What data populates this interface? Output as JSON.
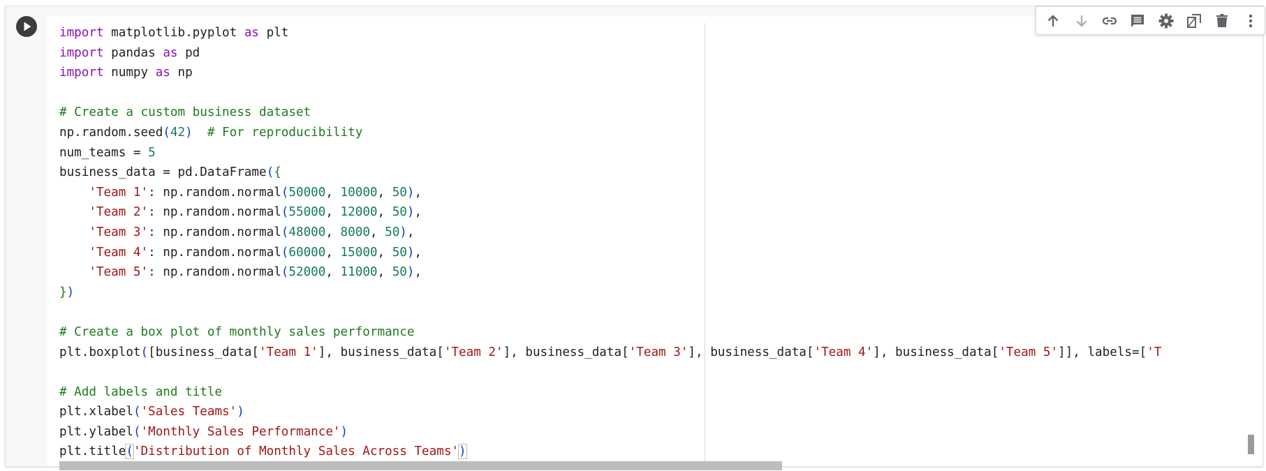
{
  "cell": {
    "run_button_label": "Run cell",
    "code_lines": [
      [
        {
          "t": "import",
          "c": "kw"
        },
        {
          "t": " matplotlib.pyplot "
        },
        {
          "t": "as",
          "c": "kw"
        },
        {
          "t": " plt"
        }
      ],
      [
        {
          "t": "import",
          "c": "kw"
        },
        {
          "t": " pandas "
        },
        {
          "t": "as",
          "c": "kw"
        },
        {
          "t": " pd"
        }
      ],
      [
        {
          "t": "import",
          "c": "kw"
        },
        {
          "t": " numpy "
        },
        {
          "t": "as",
          "c": "kw"
        },
        {
          "t": " np"
        }
      ],
      [],
      [
        {
          "t": "# Create a custom business dataset",
          "c": "cm"
        }
      ],
      [
        {
          "t": "np.random.seed"
        },
        {
          "t": "(",
          "c": "br"
        },
        {
          "t": "42",
          "c": "nm"
        },
        {
          "t": ")",
          "c": "br"
        },
        {
          "t": "  "
        },
        {
          "t": "# For reproducibility",
          "c": "cm"
        }
      ],
      [
        {
          "t": "num_teams = "
        },
        {
          "t": "5",
          "c": "nm"
        }
      ],
      [
        {
          "t": "business_data = pd.DataFrame"
        },
        {
          "t": "(",
          "c": "br"
        },
        {
          "t": "{",
          "c": "cm"
        }
      ],
      [
        {
          "t": "    "
        },
        {
          "t": "'Team 1'",
          "c": "st"
        },
        {
          "t": ": np.random.normal"
        },
        {
          "t": "(",
          "c": "br"
        },
        {
          "t": "50000",
          "c": "nm"
        },
        {
          "t": ", "
        },
        {
          "t": "10000",
          "c": "nm"
        },
        {
          "t": ", "
        },
        {
          "t": "50",
          "c": "nm"
        },
        {
          "t": ")",
          "c": "br"
        },
        {
          "t": ","
        }
      ],
      [
        {
          "t": "    "
        },
        {
          "t": "'Team 2'",
          "c": "st"
        },
        {
          "t": ": np.random.normal"
        },
        {
          "t": "(",
          "c": "br"
        },
        {
          "t": "55000",
          "c": "nm"
        },
        {
          "t": ", "
        },
        {
          "t": "12000",
          "c": "nm"
        },
        {
          "t": ", "
        },
        {
          "t": "50",
          "c": "nm"
        },
        {
          "t": ")",
          "c": "br"
        },
        {
          "t": ","
        }
      ],
      [
        {
          "t": "    "
        },
        {
          "t": "'Team 3'",
          "c": "st"
        },
        {
          "t": ": np.random.normal"
        },
        {
          "t": "(",
          "c": "br"
        },
        {
          "t": "48000",
          "c": "nm"
        },
        {
          "t": ", "
        },
        {
          "t": "8000",
          "c": "nm"
        },
        {
          "t": ", "
        },
        {
          "t": "50",
          "c": "nm"
        },
        {
          "t": ")",
          "c": "br"
        },
        {
          "t": ","
        }
      ],
      [
        {
          "t": "    "
        },
        {
          "t": "'Team 4'",
          "c": "st"
        },
        {
          "t": ": np.random.normal"
        },
        {
          "t": "(",
          "c": "br"
        },
        {
          "t": "60000",
          "c": "nm"
        },
        {
          "t": ", "
        },
        {
          "t": "15000",
          "c": "nm"
        },
        {
          "t": ", "
        },
        {
          "t": "50",
          "c": "nm"
        },
        {
          "t": ")",
          "c": "br"
        },
        {
          "t": ","
        }
      ],
      [
        {
          "t": "    "
        },
        {
          "t": "'Team 5'",
          "c": "st"
        },
        {
          "t": ": np.random.normal"
        },
        {
          "t": "(",
          "c": "br"
        },
        {
          "t": "52000",
          "c": "nm"
        },
        {
          "t": ", "
        },
        {
          "t": "11000",
          "c": "nm"
        },
        {
          "t": ", "
        },
        {
          "t": "50",
          "c": "nm"
        },
        {
          "t": ")",
          "c": "br"
        },
        {
          "t": ","
        }
      ],
      [
        {
          "t": "}",
          "c": "cm"
        },
        {
          "t": ")",
          "c": "br"
        }
      ],
      [],
      [
        {
          "t": "# Create a box plot of monthly sales performance",
          "c": "cm"
        }
      ],
      [
        {
          "t": "plt.boxplot"
        },
        {
          "t": "(",
          "c": "br"
        },
        {
          "t": "["
        },
        {
          "t": "business_data["
        },
        {
          "t": "'Team 1'",
          "c": "st"
        },
        {
          "t": "], business_data["
        },
        {
          "t": "'Team 2'",
          "c": "st"
        },
        {
          "t": "], business_data["
        },
        {
          "t": "'Team 3'",
          "c": "st"
        },
        {
          "t": "], business_data["
        },
        {
          "t": "'Team 4'",
          "c": "st"
        },
        {
          "t": "], business_data["
        },
        {
          "t": "'Team 5'",
          "c": "st"
        },
        {
          "t": "]], labels=["
        },
        {
          "t": "'T",
          "c": "st"
        }
      ],
      [],
      [
        {
          "t": "# Add labels and title",
          "c": "cm"
        }
      ],
      [
        {
          "t": "plt.xlabel"
        },
        {
          "t": "(",
          "c": "br"
        },
        {
          "t": "'Sales Teams'",
          "c": "st"
        },
        {
          "t": ")",
          "c": "br"
        }
      ],
      [
        {
          "t": "plt.ylabel"
        },
        {
          "t": "(",
          "c": "br"
        },
        {
          "t": "'Monthly Sales Performance'",
          "c": "st"
        },
        {
          "t": ")",
          "c": "br"
        }
      ],
      [
        {
          "t": "plt.title"
        },
        {
          "t": "(",
          "c": "br cur-br"
        },
        {
          "t": "'Distribution of Monthly Sales Across Teams'",
          "c": "st"
        },
        {
          "t": ")",
          "c": "br cur-br"
        }
      ]
    ]
  },
  "toolbar": {
    "buttons": [
      {
        "name": "move-cell-up-button",
        "icon": "arrow-up-icon",
        "color": "#5f6368"
      },
      {
        "name": "move-cell-down-button",
        "icon": "arrow-down-icon",
        "color": "#b0b0b0"
      },
      {
        "name": "copy-link-button",
        "icon": "link-icon",
        "color": "#5f6368"
      },
      {
        "name": "add-comment-button",
        "icon": "comment-icon",
        "color": "#5f6368"
      },
      {
        "name": "cell-settings-button",
        "icon": "gear-icon",
        "color": "#5f6368"
      },
      {
        "name": "mirror-cell-button",
        "icon": "mirror-cell-icon",
        "color": "#5f6368"
      },
      {
        "name": "delete-cell-button",
        "icon": "trash-icon",
        "color": "#5f6368"
      },
      {
        "name": "more-actions-button",
        "icon": "more-vert-icon",
        "color": "#5f6368"
      }
    ]
  }
}
